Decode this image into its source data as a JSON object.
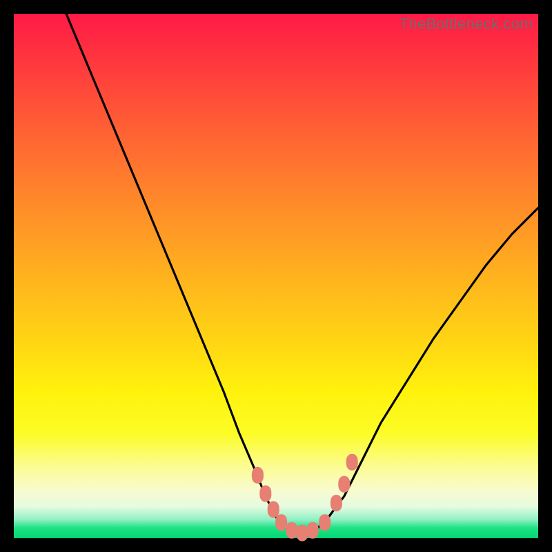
{
  "watermark": "TheBottleneck.com",
  "colors": {
    "frame": "#000000",
    "marker": "#e77f73",
    "curve": "#000000"
  },
  "chart_data": {
    "type": "line",
    "title": "",
    "xlabel": "",
    "ylabel": "",
    "xlim": [
      0,
      100
    ],
    "ylim": [
      0,
      100
    ],
    "grid": false,
    "legend": false,
    "series": [
      {
        "name": "bottleneck-curve",
        "x": [
          10,
          15,
          20,
          25,
          30,
          35,
          40,
          43,
          46,
          48,
          50,
          52,
          54,
          56,
          58,
          60,
          63,
          66,
          70,
          75,
          80,
          85,
          90,
          95,
          100
        ],
        "y": [
          100,
          88,
          76,
          64,
          52,
          40,
          28,
          20,
          13,
          8,
          4,
          2,
          1,
          1,
          2,
          4,
          8,
          14,
          22,
          30,
          38,
          45,
          52,
          58,
          63
        ]
      }
    ],
    "markers": {
      "name": "highlight-points",
      "x": [
        46.5,
        48,
        49.5,
        51,
        53,
        55,
        57,
        59.3,
        61.5,
        63,
        64.5
      ],
      "y": [
        12,
        8.5,
        5.5,
        3,
        1.5,
        1,
        1.5,
        3,
        6.7,
        10.3,
        14.5
      ]
    }
  }
}
